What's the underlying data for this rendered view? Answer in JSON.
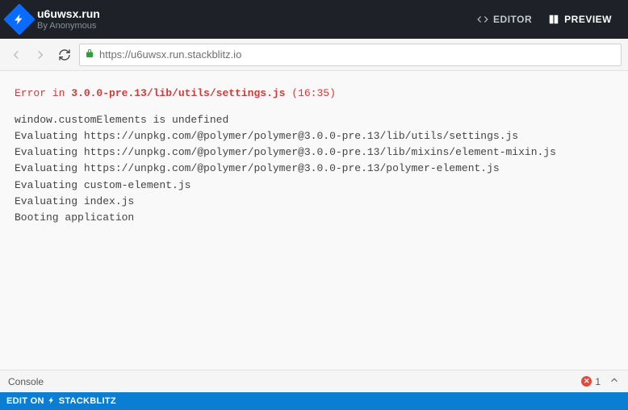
{
  "header": {
    "title": "u6uwsx.run",
    "byline": "By Anonymous",
    "editor_label": "EDITOR",
    "preview_label": "PREVIEW"
  },
  "nav": {
    "url": "https://u6uwsx.run.stackblitz.io"
  },
  "error": {
    "prefix": "Error in ",
    "file": "3.0.0-pre.13/lib/utils/settings.js",
    "loc": " (16:35)",
    "stack": [
      "window.customElements is undefined",
      "Evaluating https://unpkg.com/@polymer/polymer@3.0.0-pre.13/lib/utils/settings.js",
      "Evaluating https://unpkg.com/@polymer/polymer@3.0.0-pre.13/lib/mixins/element-mixin.js",
      "Evaluating https://unpkg.com/@polymer/polymer@3.0.0-pre.13/polymer-element.js",
      "Evaluating custom-element.js",
      "Evaluating index.js",
      "Booting application"
    ]
  },
  "console": {
    "label": "Console",
    "error_count": "1"
  },
  "footer": {
    "prefix": "EDIT ON",
    "brand": "STACKBLITZ"
  }
}
